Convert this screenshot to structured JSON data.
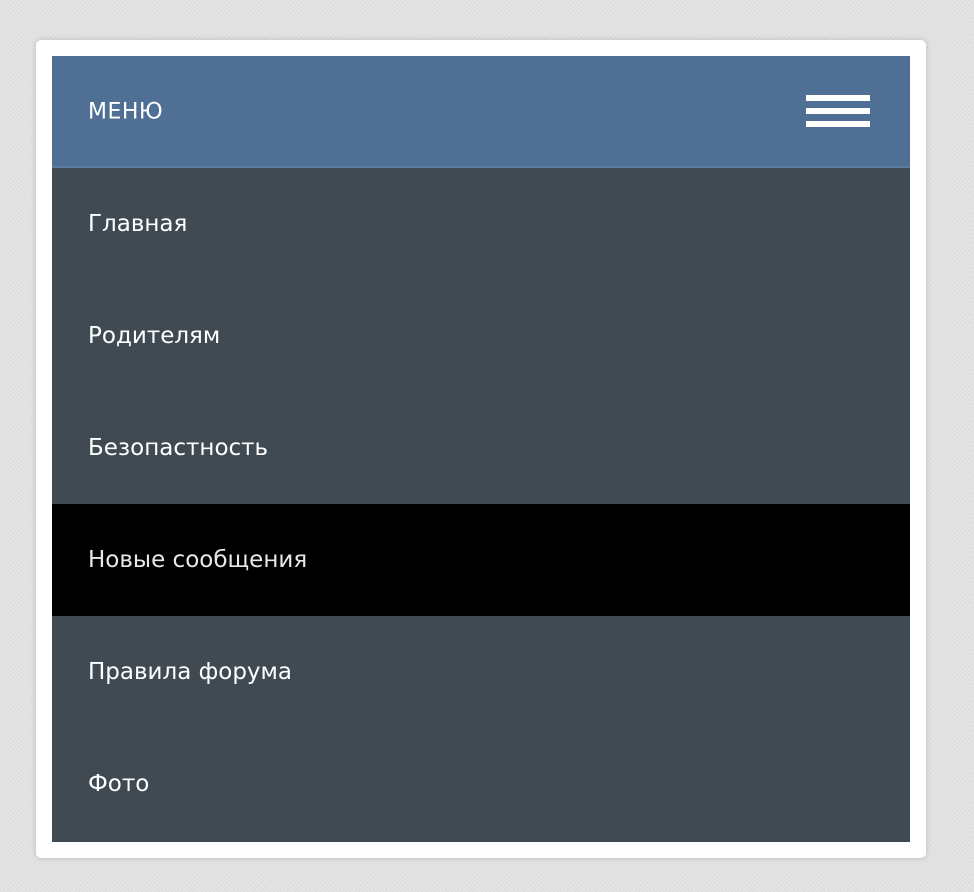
{
  "header": {
    "title": "МЕНЮ",
    "toggle_icon": "hamburger-menu-icon"
  },
  "menu": {
    "items": [
      {
        "label": "Главная"
      },
      {
        "label": "Родителям"
      },
      {
        "label": "Безопастность"
      },
      {
        "label": "Новые сообщения",
        "active": true
      },
      {
        "label": "Правила форума"
      },
      {
        "label": "Фото"
      }
    ]
  },
  "colors": {
    "header_bg": "#4f6f95",
    "menu_bg": "#3f4a53",
    "active_bg": "#000000",
    "text": "#ffffff",
    "page_bg": "#e3e3e3"
  }
}
